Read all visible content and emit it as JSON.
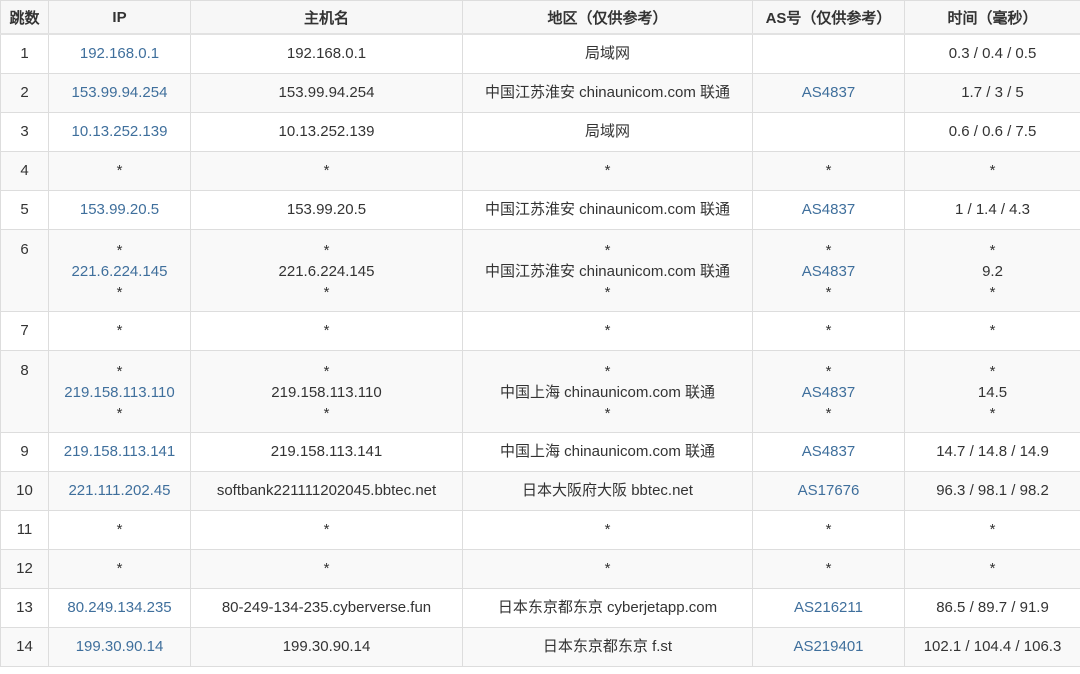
{
  "header": {
    "hop": "跳数",
    "ip": "IP",
    "hostname": "主机名",
    "region": "地区（仅供参考）",
    "as": "AS号（仅供参考）",
    "time": "时间（毫秒）"
  },
  "rows": [
    {
      "hop": "1",
      "ip": [
        "192.168.0.1"
      ],
      "hostname": [
        "192.168.0.1"
      ],
      "region": [
        "局域网"
      ],
      "as": [
        ""
      ],
      "time": [
        "0.3 / 0.4 / 0.5"
      ]
    },
    {
      "hop": "2",
      "ip": [
        "153.99.94.254"
      ],
      "hostname": [
        "153.99.94.254"
      ],
      "region": [
        "中国江苏淮安 chinaunicom.com 联通"
      ],
      "as": [
        "AS4837"
      ],
      "time": [
        "1.7 / 3 / 5"
      ]
    },
    {
      "hop": "3",
      "ip": [
        "10.13.252.139"
      ],
      "hostname": [
        "10.13.252.139"
      ],
      "region": [
        "局域网"
      ],
      "as": [
        ""
      ],
      "time": [
        "0.6 / 0.6 / 7.5"
      ]
    },
    {
      "hop": "4",
      "ip": [
        "*"
      ],
      "hostname": [
        "*"
      ],
      "region": [
        "*"
      ],
      "as": [
        "*"
      ],
      "time": [
        "*"
      ]
    },
    {
      "hop": "5",
      "ip": [
        "153.99.20.5"
      ],
      "hostname": [
        "153.99.20.5"
      ],
      "region": [
        "中国江苏淮安 chinaunicom.com 联通"
      ],
      "as": [
        "AS4837"
      ],
      "time": [
        "1 / 1.4 / 4.3"
      ]
    },
    {
      "hop": "6",
      "ip": [
        "*",
        "221.6.224.145",
        "*"
      ],
      "hostname": [
        "*",
        "221.6.224.145",
        "*"
      ],
      "region": [
        "*",
        "中国江苏淮安 chinaunicom.com 联通",
        "*"
      ],
      "as": [
        "*",
        "AS4837",
        "*"
      ],
      "time": [
        "*",
        "9.2",
        "*"
      ]
    },
    {
      "hop": "7",
      "ip": [
        "*"
      ],
      "hostname": [
        "*"
      ],
      "region": [
        "*"
      ],
      "as": [
        "*"
      ],
      "time": [
        "*"
      ]
    },
    {
      "hop": "8",
      "ip": [
        "*",
        "219.158.113.110",
        "*"
      ],
      "hostname": [
        "*",
        "219.158.113.110",
        "*"
      ],
      "region": [
        "*",
        "中国上海 chinaunicom.com 联通",
        "*"
      ],
      "as": [
        "*",
        "AS4837",
        "*"
      ],
      "time": [
        "*",
        "14.5",
        "*"
      ]
    },
    {
      "hop": "9",
      "ip": [
        "219.158.113.141"
      ],
      "hostname": [
        "219.158.113.141"
      ],
      "region": [
        "中国上海 chinaunicom.com 联通"
      ],
      "as": [
        "AS4837"
      ],
      "time": [
        "14.7 / 14.8 / 14.9"
      ]
    },
    {
      "hop": "10",
      "ip": [
        "221.111.202.45"
      ],
      "hostname": [
        "softbank221111202045.bbtec.net"
      ],
      "region": [
        "日本大阪府大阪 bbtec.net"
      ],
      "as": [
        "AS17676"
      ],
      "time": [
        "96.3 / 98.1 / 98.2"
      ]
    },
    {
      "hop": "11",
      "ip": [
        "*"
      ],
      "hostname": [
        "*"
      ],
      "region": [
        "*"
      ],
      "as": [
        "*"
      ],
      "time": [
        "*"
      ]
    },
    {
      "hop": "12",
      "ip": [
        "*"
      ],
      "hostname": [
        "*"
      ],
      "region": [
        "*"
      ],
      "as": [
        "*"
      ],
      "time": [
        "*"
      ]
    },
    {
      "hop": "13",
      "ip": [
        "80.249.134.235"
      ],
      "hostname": [
        "80-249-134-235.cyberverse.fun"
      ],
      "region": [
        "日本东京都东京 cyberjetapp.com"
      ],
      "as": [
        "AS216211"
      ],
      "time": [
        "86.5 / 89.7 / 91.9"
      ]
    },
    {
      "hop": "14",
      "ip": [
        "199.30.90.14"
      ],
      "hostname": [
        "199.30.90.14"
      ],
      "region": [
        "日本东京都东京 f.st"
      ],
      "as": [
        "AS219401"
      ],
      "time": [
        "102.1 / 104.4 / 106.3"
      ]
    }
  ],
  "colors": {
    "link": "#3f6f9c",
    "text": "#333333",
    "border": "#dddddd",
    "header_bg": "#f7f7f7",
    "stripe_bg": "#f9f9f9"
  }
}
